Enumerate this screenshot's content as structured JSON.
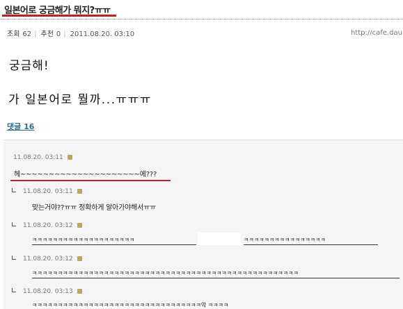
{
  "post": {
    "title": "일본어로 궁금해가 뭐지?ㅠㅠ",
    "views_label": "조회",
    "views": "62",
    "recommend_label": "추천",
    "recommend": "0",
    "date": "2011.08.20. 03:10",
    "url": "http://cafe.dau",
    "line1": "궁금해!",
    "line2": "가 일본어로 뭘까...ㅠㅠㅠ",
    "reply_count_label": "댓글 16"
  },
  "comments": [
    {
      "meta": "11.08.20. 03:11",
      "text": "헤~~~~~~~~~~~~~~~~~~~~~에???"
    },
    {
      "meta": "11.08.20. 03:11",
      "text": "맞는거야??ㅠㅠ 정확하게 알아가야해서ㅠㅠ"
    },
    {
      "meta": "11.08.20. 03:12",
      "text_left": "ㅋㅋㅋㅋㅋㅋㅋㅋㅋㅋㅋㅋㅋㅋㅋㅋㅋㅋㅋㅋ",
      "text_right": "ㅋㅋㅋㅋㅋㅋㅋㅋㅋㅋㅋㅋㅋㅋㅋㅋ"
    },
    {
      "meta": "11.08.20. 03:12",
      "text": "ㅋㅋㅋㅋㅋㅋㅋㅋㅋㅋㅋㅋㅋㅋㅋㅋㅋㅋㅋㅋㅋㅋㅋㅋㅋㅋㅋㅋㅋㅋㅋㅋㅋㅋㅋㅋㅋㅋㅋㅋㅋㅋㅋㅋㅋㅋㅋㅋㅋㅋㅋㅋ"
    },
    {
      "meta": "11.08.20. 03:13",
      "text": "ㅋㅋㅋㅋㅋㅋㅋㅋㅋㅋㅋㅋㅋㅋㅋㅋㅋㅋㅋㅋㅋㅋㅋㅋㅋㅋㅋㅋㅋㅋㅋㅋㅋ악 ㅋㅋㅋㅋ"
    }
  ],
  "colors": {
    "accent_red": "#b8202a",
    "link_blue": "#2d6a8a",
    "comment_bg": "#f4f5f4"
  }
}
